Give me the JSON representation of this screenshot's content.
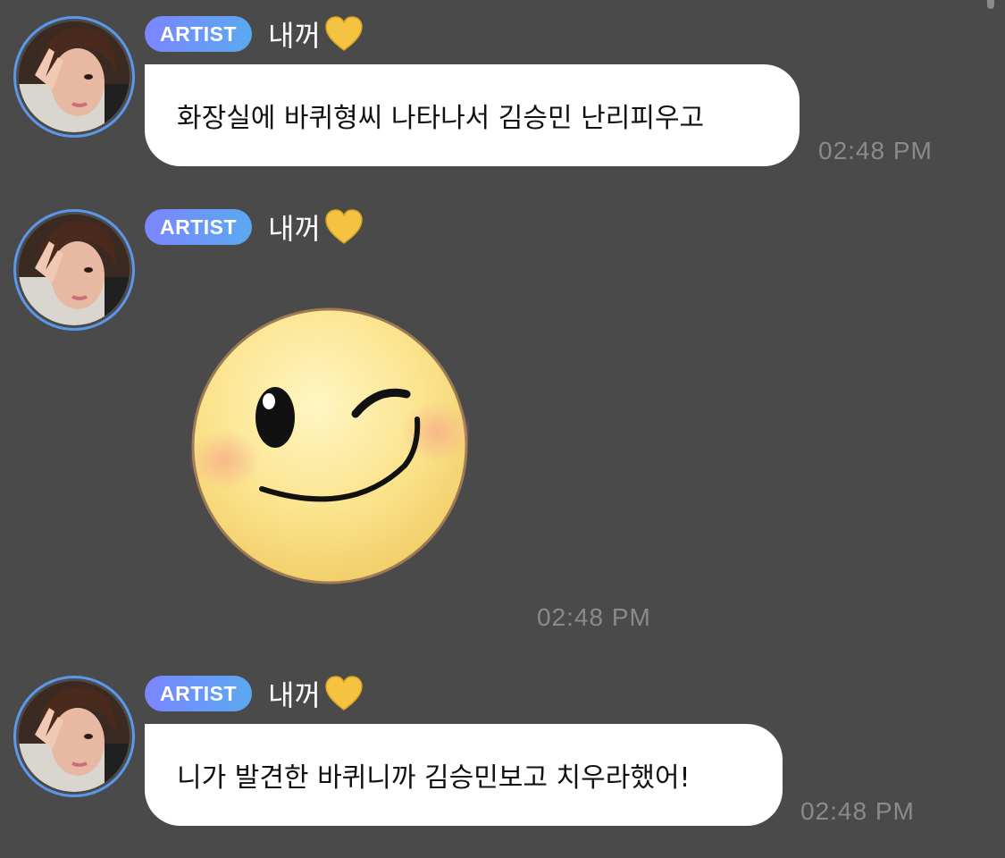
{
  "messages": [
    {
      "badge": "ARTIST",
      "sender": "내꺼",
      "heart_icon": "yellow-heart-icon",
      "type": "text",
      "text": "화장실에 바퀴형씨 나타나서 김승민 난리피우고",
      "time": "02:48 PM"
    },
    {
      "badge": "ARTIST",
      "sender": "내꺼",
      "heart_icon": "yellow-heart-icon",
      "type": "sticker",
      "sticker_icon": "winking-smile-emoticon",
      "time": "02:48 PM"
    },
    {
      "badge": "ARTIST",
      "sender": "내꺼",
      "heart_icon": "yellow-heart-icon",
      "type": "text",
      "text": "니가 발견한 바퀴니까 김승민보고 치우라했어!",
      "time": "02:48 PM"
    }
  ],
  "colors": {
    "background": "#4a4a4a",
    "bubble": "#ffffff",
    "badge_gradient_start": "#7b86ff",
    "badge_gradient_end": "#5aa9f0",
    "avatar_ring": "#5c97ea",
    "timestamp": "#8a8a8a",
    "heart": "#f5c342"
  }
}
